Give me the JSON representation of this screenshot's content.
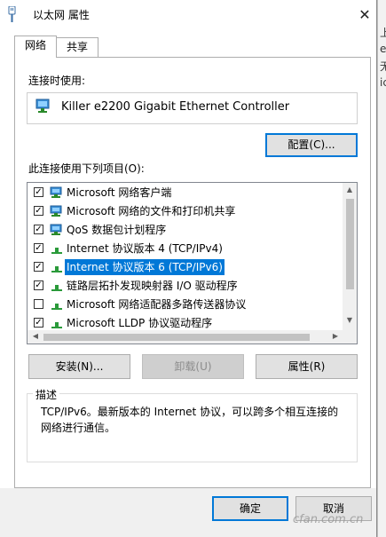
{
  "window": {
    "title": "以太网 属性",
    "close_glyph": "✕"
  },
  "tabs": [
    {
      "label": "网络",
      "active": true
    },
    {
      "label": "共享",
      "active": false
    }
  ],
  "connection": {
    "label": "连接时使用:",
    "adapter_name": "Killer e2200 Gigabit Ethernet Controller",
    "configure_button": "配置(C)..."
  },
  "items": {
    "label": "此连接使用下列项目(O):",
    "rows": [
      {
        "checked": true,
        "icon": "network-client-icon",
        "text": "Microsoft 网络客户端"
      },
      {
        "checked": true,
        "icon": "file-printer-sharing-icon",
        "text": "Microsoft 网络的文件和打印机共享"
      },
      {
        "checked": true,
        "icon": "qos-scheduler-icon",
        "text": "QoS 数据包计划程序"
      },
      {
        "checked": true,
        "icon": "protocol-icon",
        "text": "Internet 协议版本 4 (TCP/IPv4)"
      },
      {
        "checked": true,
        "icon": "protocol-icon",
        "text": "Internet 协议版本 6 (TCP/IPv6)",
        "selected": true
      },
      {
        "checked": true,
        "icon": "protocol-icon",
        "text": "链路层拓扑发现映射器 I/O 驱动程序"
      },
      {
        "checked": false,
        "icon": "protocol-icon",
        "text": "Microsoft 网络适配器多路传送器协议"
      },
      {
        "checked": true,
        "icon": "protocol-icon",
        "text": "Microsoft LLDP 协议驱动程序"
      }
    ]
  },
  "actions": {
    "install": "安装(N)...",
    "uninstall": "卸载(U)",
    "properties": "属性(R)"
  },
  "description": {
    "legend": "描述",
    "text": "TCP/IPv6。最新版本的 Internet 协议，可以跨多个相互连接的网络进行通信。"
  },
  "footer": {
    "ok": "确定",
    "cancel": "取消"
  },
  "background": {
    "edge_chars": [
      "上",
      "e",
      "无",
      "ic"
    ]
  },
  "watermark": "cfan.com.cn",
  "colors": {
    "selection": "#0078d7",
    "default_button_border": "#0078d7",
    "dialog_bg": "#ffffff",
    "footer_bg": "#f0f0f0"
  }
}
